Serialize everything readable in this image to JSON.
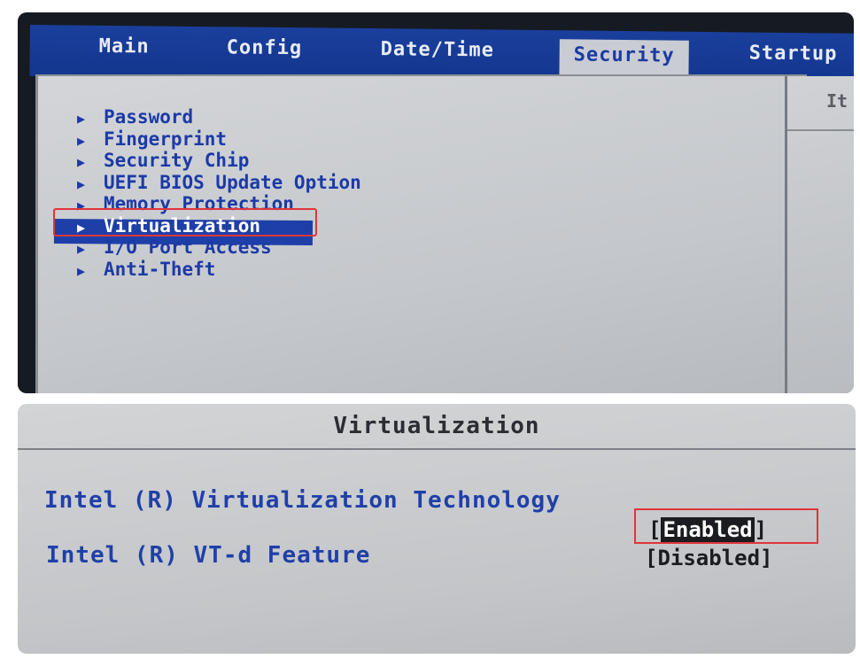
{
  "tabs": {
    "main": "Main",
    "config": "Config",
    "date_time": "Date/Time",
    "security": "Security",
    "startup": "Startup"
  },
  "right_pane_label": "It",
  "security_menu": {
    "items": [
      {
        "label": "Password"
      },
      {
        "label": "Fingerprint"
      },
      {
        "label": "Security Chip"
      },
      {
        "label": "UEFI BIOS Update Option"
      },
      {
        "label": "Memory Protection"
      },
      {
        "label": "Virtualization",
        "selected": true
      },
      {
        "label": "I/O Port Access"
      },
      {
        "label": "Anti-Theft"
      }
    ]
  },
  "virtualization_panel": {
    "title": "Virtualization",
    "vt": {
      "label": "Intel (R) Virtualization Technology",
      "value_open": "[",
      "value": "Enabled",
      "value_close": "]"
    },
    "vtd": {
      "label": "Intel (R) VT-d Feature",
      "value": "[Disabled]"
    }
  },
  "colors": {
    "tabbar": "#13368e",
    "menu_text": "#1c3aa6",
    "highlight_box": "#e0353a"
  }
}
